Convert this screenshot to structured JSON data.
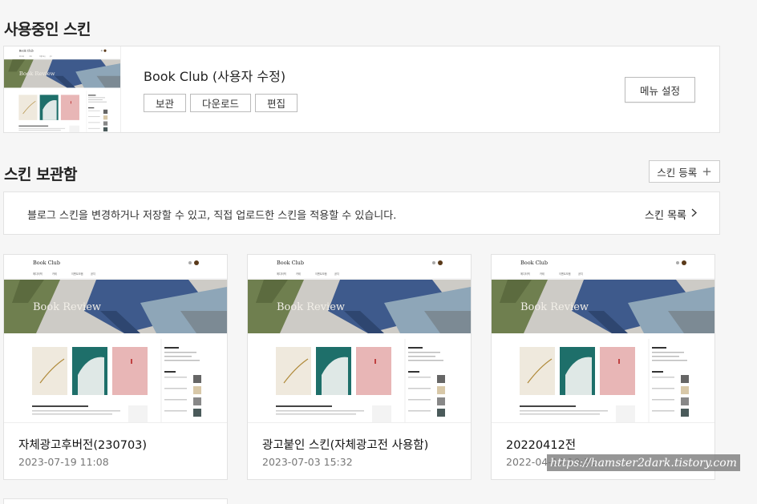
{
  "current": {
    "title": "사용중인 스킨",
    "name": "Book Club (사용자 수정)",
    "actions": [
      "보관",
      "다운로드",
      "편집"
    ],
    "menu_button": "메뉴 설정"
  },
  "storage": {
    "title": "스킨 보관함",
    "register_button": "스킨 등록",
    "info": "블로그 스킨을 변경하거나 저장할 수 있고, 직접 업로드한 스킨을 적용할 수 있습니다.",
    "list_link": "스킨 목록",
    "items": [
      {
        "name": "자체광고후버전(230703)",
        "date": "2023-07-19 11:08"
      },
      {
        "name": "광고붙인 스킨(자체광고전 사용함)",
        "date": "2023-07-03 15:32"
      },
      {
        "name": "20220412전",
        "date": "2022-04-12 10:32"
      }
    ]
  },
  "preview": {
    "logo": "Book Club",
    "hero": "Book Review",
    "nav": [
      "에디터픽",
      "카테",
      "이벤트모음",
      "공지"
    ]
  },
  "watermark": "https://hamster2dark.tistory.com",
  "colors": {
    "accent_blue": "#3e5a8c",
    "accent_teal": "#1e6f6a",
    "accent_pink": "#e8b6b6",
    "olive": "#6f7f4f"
  }
}
